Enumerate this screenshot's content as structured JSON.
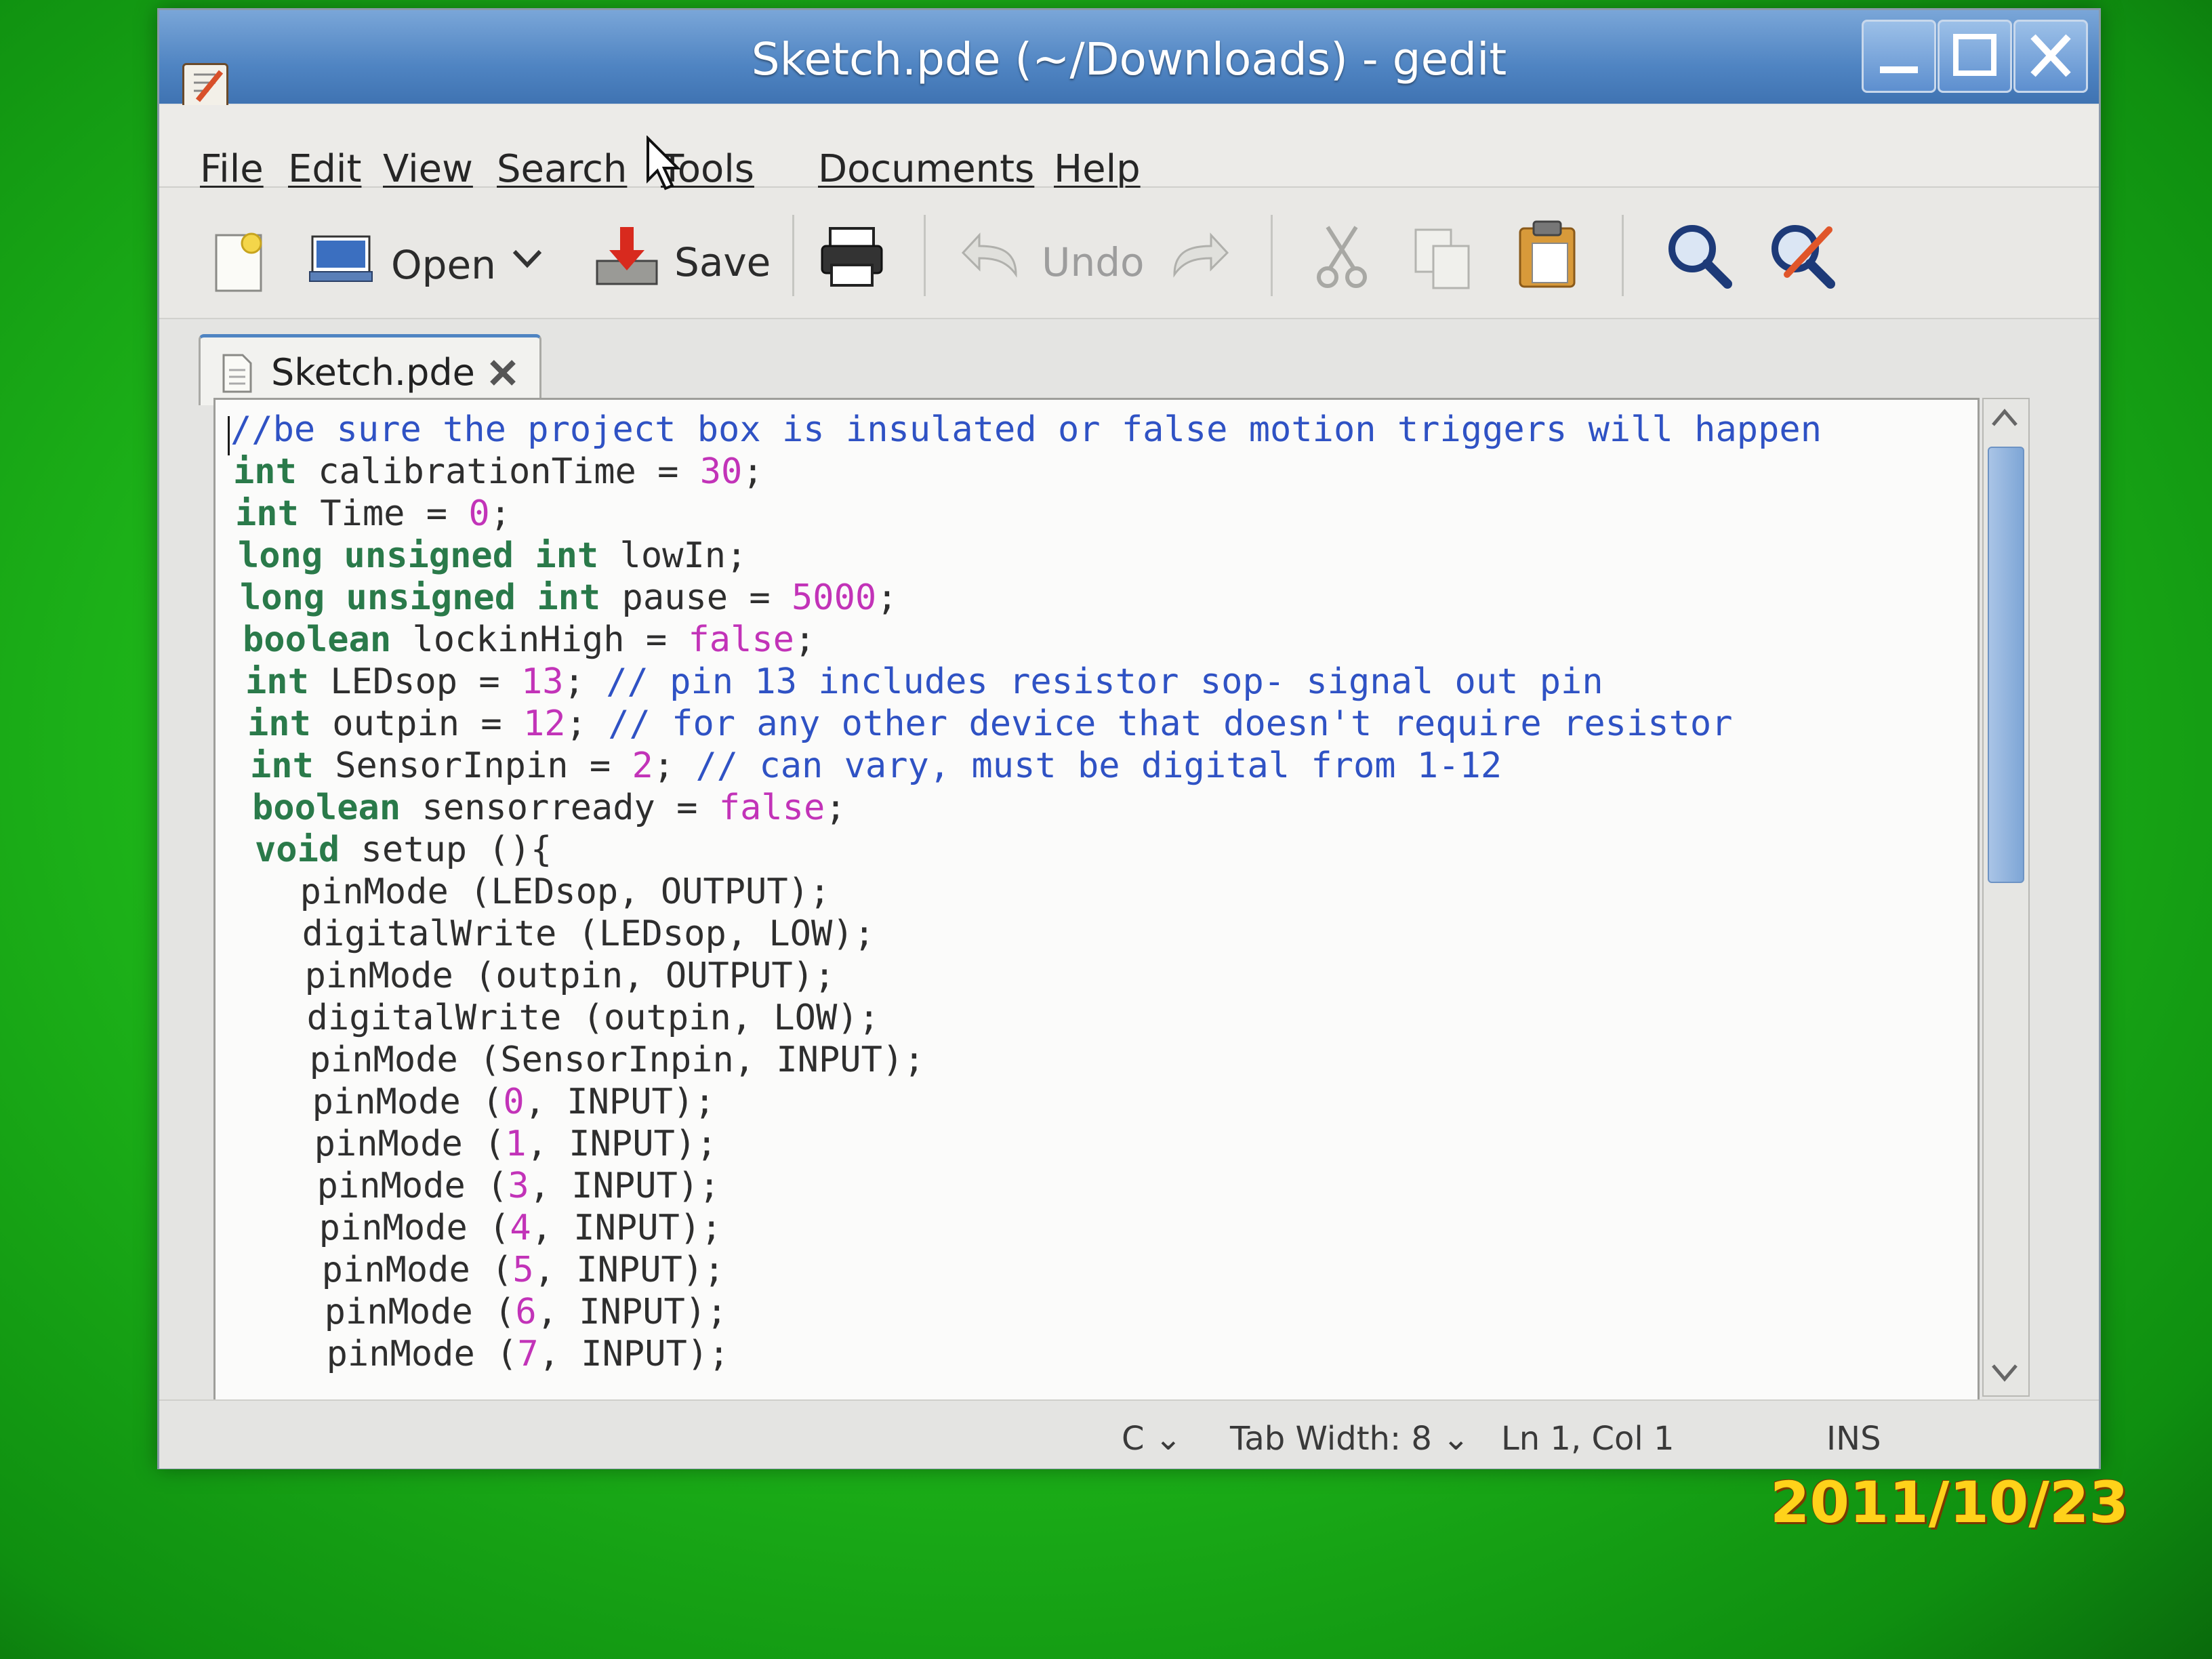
{
  "window": {
    "title": "Sketch.pde (~/Downloads) - gedit"
  },
  "menu": {
    "file": "File",
    "edit": "Edit",
    "view": "View",
    "search": "Search",
    "tools": "Tools",
    "documents": "Documents",
    "help": "Help"
  },
  "toolbar": {
    "open_label": "Open",
    "save_label": "Save",
    "undo_label": "Undo"
  },
  "tab": {
    "label": "Sketch.pde"
  },
  "editor": {
    "lines": [
      "//be sure the project box is insulated or false motion triggers will happen",
      "int calibrationTime = 30;",
      "int Time = 0;",
      "long unsigned int lowIn;",
      "long unsigned int pause = 5000;",
      "boolean lockinHigh = false;",
      "int LEDsop = 13; // pin 13 includes resistor sop- signal out pin",
      "int outpin = 12; // for any other device that doesn't require resistor",
      "int SensorInpin = 2; // can vary, must be digital from 1-12",
      "boolean sensorready = false;",
      "void setup (){",
      "  pinMode (LEDsop, OUTPUT);",
      "  digitalWrite (LEDsop, LOW);",
      "  pinMode (outpin, OUTPUT);",
      "  digitalWrite (outpin, LOW);",
      "  pinMode (SensorInpin, INPUT);",
      "  pinMode (0, INPUT);",
      "  pinMode (1, INPUT);",
      "  pinMode (3, INPUT);",
      "  pinMode (4, INPUT);",
      "  pinMode (5, INPUT);",
      "  pinMode (6, INPUT);",
      "  pinMode (7, INPUT);"
    ]
  },
  "statusbar": {
    "language": "C",
    "tab_width": "Tab Width: 8",
    "position": "Ln 1, Col 1",
    "mode": "INS"
  },
  "photo": {
    "date_stamp": "2011/10/23"
  },
  "colors": {
    "titlebar": "#4f84c2",
    "keyword": "#2a7a4a",
    "number": "#c233b8",
    "comment": "#2f52c4",
    "date_stamp": "#ffd21a"
  }
}
